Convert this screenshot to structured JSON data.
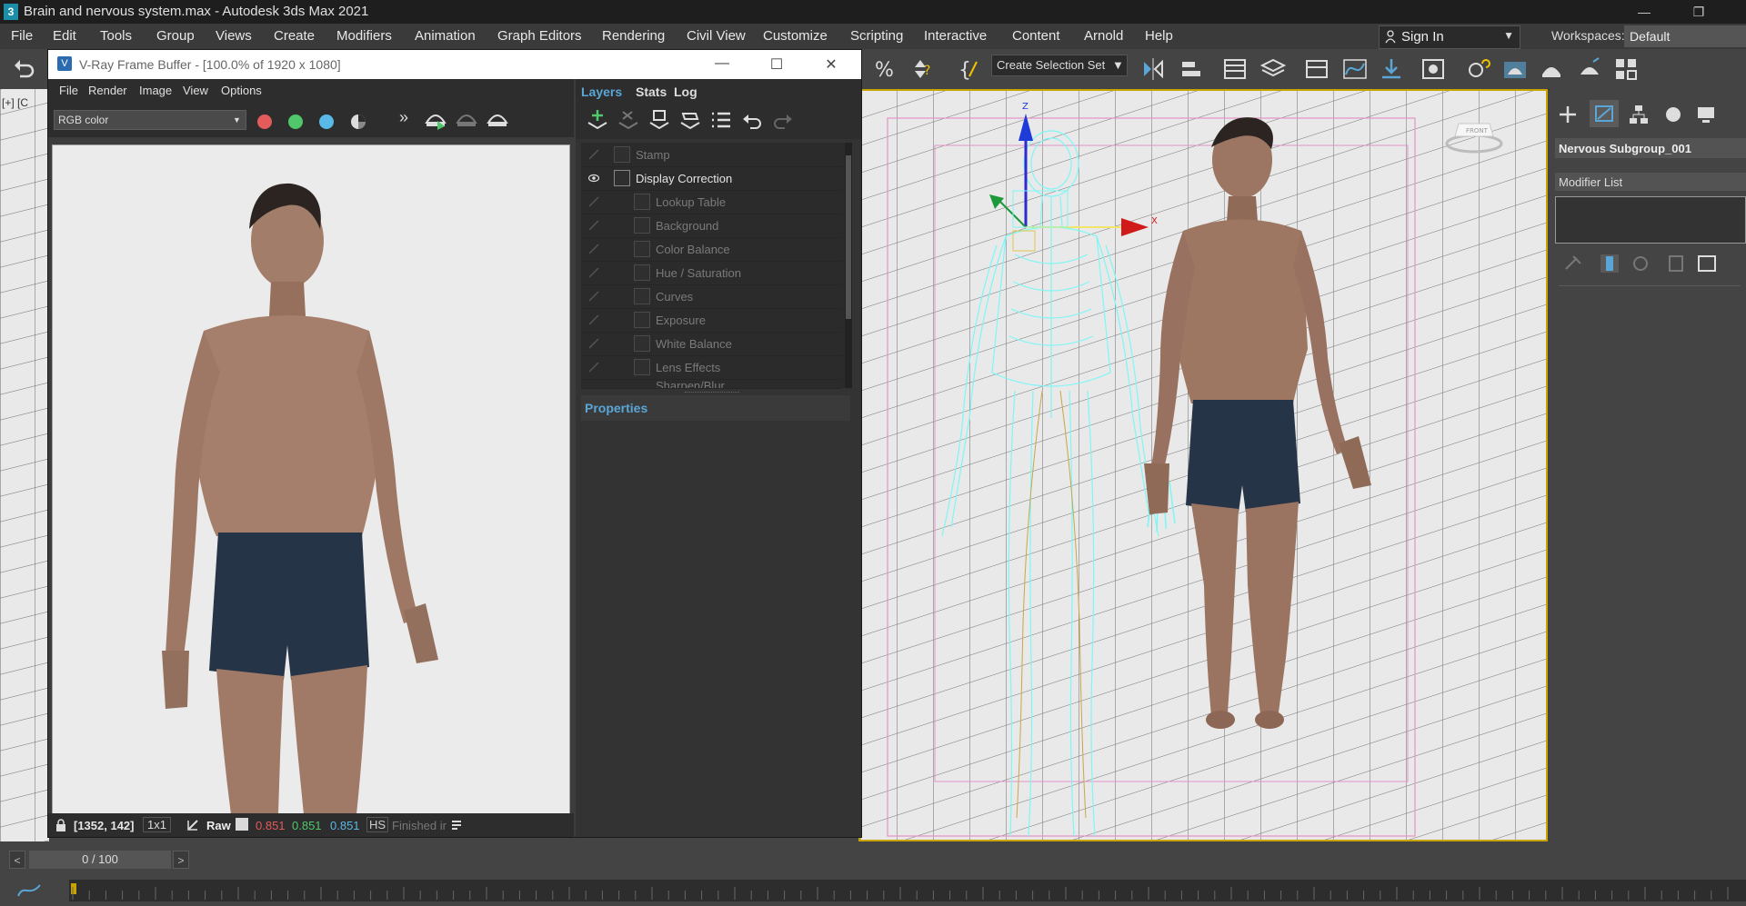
{
  "app": {
    "title": "Brain and nervous system.max - Autodesk 3ds Max 2021",
    "icon_letter": "3"
  },
  "menubar": {
    "items": [
      "File",
      "Edit",
      "Tools",
      "Group",
      "Views",
      "Create",
      "Modifiers",
      "Animation",
      "Graph Editors",
      "Rendering",
      "Civil View",
      "Customize",
      "Scripting",
      "Interactive",
      "Content",
      "Arnold",
      "Help"
    ],
    "sign_in": "Sign In",
    "workspaces_label": "Workspaces:",
    "workspaces_value": "Default"
  },
  "toolbar": {
    "selection_set": "Create Selection Set"
  },
  "viewport": {
    "label": "[+] [C",
    "viewcube_label": "FRONT",
    "gizmo_x": "X",
    "gizmo_z": "Z"
  },
  "vfb": {
    "title": "V-Ray Frame Buffer - [100.0% of 1920 x 1080]",
    "icon_letter": "V",
    "menu": [
      "File",
      "Render",
      "Image",
      "View",
      "Options"
    ],
    "channel": "RGB color",
    "status": {
      "coords": "[1352, 142]",
      "zoom": "1x1",
      "mode": "Raw",
      "r": "0.851",
      "g": "0.851",
      "b": "0.851",
      "hsv": "HS",
      "progress": "Finished ir"
    }
  },
  "layers_panel": {
    "tabs": [
      "Layers",
      "Stats",
      "Log"
    ],
    "rows": [
      {
        "label": "Stamp",
        "active": false
      },
      {
        "label": "Display Correction",
        "active": true
      },
      {
        "label": "Lookup Table",
        "active": false
      },
      {
        "label": "Background",
        "active": false
      },
      {
        "label": "Color Balance",
        "active": false
      },
      {
        "label": "Hue / Saturation",
        "active": false
      },
      {
        "label": "Curves",
        "active": false
      },
      {
        "label": "Exposure",
        "active": false
      },
      {
        "label": "White Balance",
        "active": false
      },
      {
        "label": "Lens Effects",
        "active": false
      },
      {
        "label": "Sharpen/Blur",
        "active": false
      }
    ],
    "properties_label": "Properties"
  },
  "command_panel": {
    "object_name": "Nervous Subgroup_001",
    "modifier_list": "Modifier List"
  },
  "timeline": {
    "frame": "0 / 100",
    "prev": "<",
    "next": ">"
  },
  "colors": {
    "accent_blue": "#5aa6d6",
    "wire_cyan": "#7ff6f6",
    "red_dot": "#e35b5b",
    "green_dot": "#4fc76a",
    "blue_dot": "#59b9e8"
  }
}
